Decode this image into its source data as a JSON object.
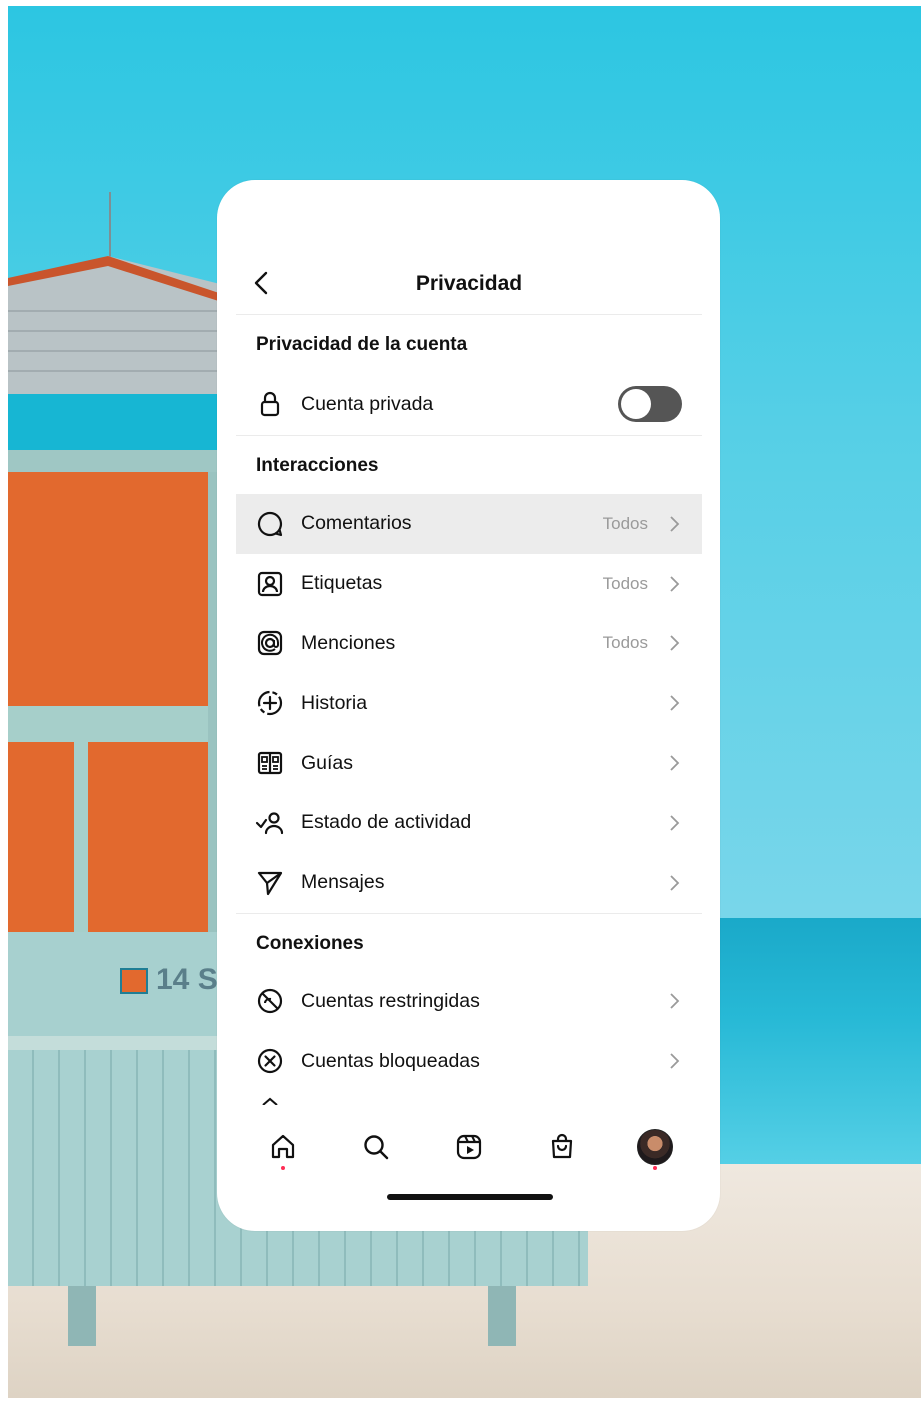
{
  "header": {
    "title": "Privacidad"
  },
  "sections": {
    "account": {
      "title": "Privacidad de la cuenta"
    },
    "interactions": {
      "title": "Interacciones"
    },
    "connections": {
      "title": "Conexiones"
    }
  },
  "account": {
    "private_label": "Cuenta privada",
    "private_enabled": false
  },
  "interactions": {
    "items": [
      {
        "label": "Comentarios",
        "value": "Todos",
        "icon": "comment-icon"
      },
      {
        "label": "Etiquetas",
        "value": "Todos",
        "icon": "tag-person-icon"
      },
      {
        "label": "Menciones",
        "value": "Todos",
        "icon": "mention-icon"
      },
      {
        "label": "Historia",
        "value": "",
        "icon": "story-add-icon"
      },
      {
        "label": "Guías",
        "value": "",
        "icon": "guides-icon"
      },
      {
        "label": "Estado de actividad",
        "value": "",
        "icon": "activity-status-icon"
      },
      {
        "label": "Mensajes",
        "value": "",
        "icon": "send-icon"
      }
    ]
  },
  "connections": {
    "items": [
      {
        "label": "Cuentas restringidas",
        "icon": "restricted-icon"
      },
      {
        "label": "Cuentas bloqueadas",
        "icon": "blocked-icon"
      }
    ]
  },
  "tabbar": {
    "items": [
      {
        "name": "home-icon",
        "dot": true
      },
      {
        "name": "search-icon",
        "dot": false
      },
      {
        "name": "reels-icon",
        "dot": false
      },
      {
        "name": "shop-icon",
        "dot": false
      },
      {
        "name": "profile-avatar",
        "dot": true
      }
    ]
  },
  "background": {
    "sign_text": "14 S"
  },
  "colors": {
    "sky": "#2cc6e2",
    "sea": "#1aa9c9",
    "sand": "#e7ddd0",
    "door": "#e2692e",
    "hut": "#a7d0cf",
    "highlight_row": "#ececec",
    "toggle_off": "#555555",
    "notification_dot": "#ff2d55"
  }
}
